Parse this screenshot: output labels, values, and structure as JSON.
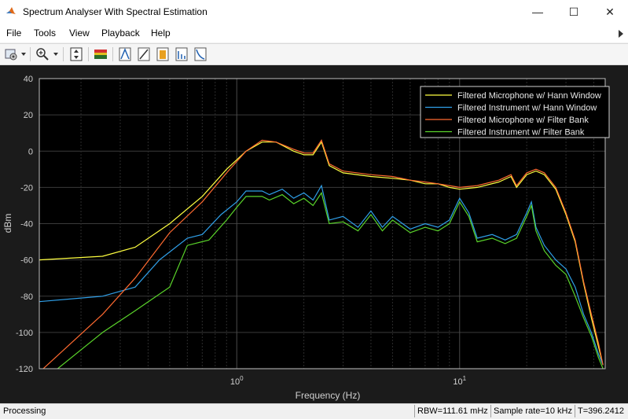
{
  "window": {
    "title": "Spectrum Analyser With Spectral Estimation",
    "minimize_glyph": "—",
    "maximize_glyph": "☐",
    "close_glyph": "✕"
  },
  "menu": {
    "items": [
      "File",
      "Tools",
      "View",
      "Playback",
      "Help"
    ]
  },
  "toolbar": {
    "icons": [
      "settings-icon",
      "zoom-in-icon",
      "scale-axes-icon",
      "spectrum-icon",
      "peak-finder-icon",
      "cursor-icon",
      "channel-measurement-icon",
      "distortion-icon",
      "ccdf-icon"
    ]
  },
  "chart_data": {
    "type": "line",
    "xlabel": "Frequency (Hz)",
    "ylabel": "dBm",
    "xscale": "log",
    "xlim": [
      0.13,
      45
    ],
    "ylim": [
      -120,
      40
    ],
    "yticks": [
      40,
      20,
      0,
      -20,
      -40,
      -60,
      -80,
      -100,
      -120
    ],
    "xtick_labels": [
      {
        "value": 1,
        "base": "10",
        "exp": "0"
      },
      {
        "value": 10,
        "base": "10",
        "exp": "1"
      }
    ],
    "grid": true,
    "legend_position": "top-right",
    "background": "#000000",
    "series": [
      {
        "name": "Filtered Microphone w/ Hann Window",
        "color": "#ffff40",
        "points": [
          [
            0.13,
            -60
          ],
          [
            0.25,
            -58
          ],
          [
            0.35,
            -53
          ],
          [
            0.5,
            -40
          ],
          [
            0.7,
            -25
          ],
          [
            0.9,
            -10
          ],
          [
            1.1,
            0
          ],
          [
            1.3,
            5
          ],
          [
            1.5,
            5
          ],
          [
            1.8,
            0
          ],
          [
            2.0,
            -2
          ],
          [
            2.2,
            -2
          ],
          [
            2.4,
            5
          ],
          [
            2.6,
            -8
          ],
          [
            3.0,
            -12
          ],
          [
            4.0,
            -14
          ],
          [
            5.0,
            -15
          ],
          [
            6.0,
            -16
          ],
          [
            7.0,
            -18
          ],
          [
            8.0,
            -18
          ],
          [
            9.0,
            -20
          ],
          [
            10.0,
            -21
          ],
          [
            12.0,
            -20
          ],
          [
            15.0,
            -17
          ],
          [
            17.0,
            -14
          ],
          [
            18.0,
            -20
          ],
          [
            20.0,
            -13
          ],
          [
            22.0,
            -11
          ],
          [
            24.0,
            -13
          ],
          [
            27.0,
            -21
          ],
          [
            30.0,
            -35
          ],
          [
            33.0,
            -50
          ],
          [
            36.0,
            -73
          ],
          [
            39.0,
            -92
          ],
          [
            42.0,
            -108
          ],
          [
            44.0,
            -118
          ]
        ]
      },
      {
        "name": "Filtered Instrument w/ Hann Window",
        "color": "#2f9fe8",
        "points": [
          [
            0.13,
            -83
          ],
          [
            0.25,
            -80
          ],
          [
            0.35,
            -75
          ],
          [
            0.45,
            -60
          ],
          [
            0.6,
            -48
          ],
          [
            0.7,
            -46
          ],
          [
            0.85,
            -35
          ],
          [
            1.0,
            -28
          ],
          [
            1.1,
            -22
          ],
          [
            1.3,
            -22
          ],
          [
            1.4,
            -24
          ],
          [
            1.6,
            -21
          ],
          [
            1.8,
            -26
          ],
          [
            2.0,
            -23
          ],
          [
            2.2,
            -27
          ],
          [
            2.4,
            -19
          ],
          [
            2.6,
            -38
          ],
          [
            3.0,
            -36
          ],
          [
            3.5,
            -42
          ],
          [
            4.0,
            -33
          ],
          [
            4.5,
            -42
          ],
          [
            5.0,
            -36
          ],
          [
            6.0,
            -43
          ],
          [
            7.0,
            -40
          ],
          [
            8.0,
            -42
          ],
          [
            9.0,
            -38
          ],
          [
            10.0,
            -26
          ],
          [
            11.0,
            -34
          ],
          [
            12.0,
            -48
          ],
          [
            14.0,
            -46
          ],
          [
            16.0,
            -49
          ],
          [
            18.0,
            -46
          ],
          [
            20.0,
            -34
          ],
          [
            21.0,
            -28
          ],
          [
            22.0,
            -42
          ],
          [
            24.0,
            -52
          ],
          [
            27.0,
            -60
          ],
          [
            30.0,
            -65
          ],
          [
            33.0,
            -75
          ],
          [
            36.0,
            -90
          ],
          [
            39.0,
            -100
          ],
          [
            42.0,
            -112
          ],
          [
            44.0,
            -118
          ]
        ]
      },
      {
        "name": "Filtered Microphone w/ Filter Bank",
        "color": "#ff6a30",
        "points": [
          [
            0.13,
            -122
          ],
          [
            0.25,
            -90
          ],
          [
            0.35,
            -70
          ],
          [
            0.5,
            -45
          ],
          [
            0.7,
            -28
          ],
          [
            0.9,
            -12
          ],
          [
            1.1,
            0
          ],
          [
            1.3,
            6
          ],
          [
            1.5,
            5
          ],
          [
            1.8,
            1
          ],
          [
            2.0,
            -1
          ],
          [
            2.2,
            -1
          ],
          [
            2.4,
            6
          ],
          [
            2.6,
            -7
          ],
          [
            3.0,
            -11
          ],
          [
            4.0,
            -13
          ],
          [
            5.0,
            -14
          ],
          [
            6.0,
            -16
          ],
          [
            7.0,
            -17
          ],
          [
            8.0,
            -18
          ],
          [
            9.0,
            -19
          ],
          [
            10.0,
            -20
          ],
          [
            12.0,
            -19
          ],
          [
            15.0,
            -16
          ],
          [
            17.0,
            -13
          ],
          [
            18.0,
            -19
          ],
          [
            20.0,
            -12
          ],
          [
            22.0,
            -10
          ],
          [
            24.0,
            -12
          ],
          [
            27.0,
            -20
          ],
          [
            30.0,
            -34
          ],
          [
            33.0,
            -49
          ],
          [
            36.0,
            -72
          ],
          [
            39.0,
            -90
          ],
          [
            42.0,
            -106
          ],
          [
            44.0,
            -118
          ]
        ]
      },
      {
        "name": "Filtered Instrument w/ Filter Bank",
        "color": "#5ad42a",
        "points": [
          [
            0.15,
            -122
          ],
          [
            0.25,
            -100
          ],
          [
            0.35,
            -88
          ],
          [
            0.5,
            -75
          ],
          [
            0.6,
            -52
          ],
          [
            0.75,
            -49
          ],
          [
            0.9,
            -38
          ],
          [
            1.0,
            -31
          ],
          [
            1.1,
            -25
          ],
          [
            1.3,
            -25
          ],
          [
            1.4,
            -27
          ],
          [
            1.6,
            -24
          ],
          [
            1.8,
            -29
          ],
          [
            2.0,
            -26
          ],
          [
            2.2,
            -30
          ],
          [
            2.4,
            -23
          ],
          [
            2.6,
            -40
          ],
          [
            3.0,
            -39
          ],
          [
            3.5,
            -44
          ],
          [
            4.0,
            -35
          ],
          [
            4.5,
            -44
          ],
          [
            5.0,
            -38
          ],
          [
            6.0,
            -45
          ],
          [
            7.0,
            -42
          ],
          [
            8.0,
            -44
          ],
          [
            9.0,
            -40
          ],
          [
            10.0,
            -28
          ],
          [
            11.0,
            -36
          ],
          [
            12.0,
            -50
          ],
          [
            14.0,
            -48
          ],
          [
            16.0,
            -51
          ],
          [
            18.0,
            -48
          ],
          [
            20.0,
            -36
          ],
          [
            21.0,
            -30
          ],
          [
            22.0,
            -44
          ],
          [
            24.0,
            -55
          ],
          [
            27.0,
            -63
          ],
          [
            30.0,
            -68
          ],
          [
            33.0,
            -80
          ],
          [
            36.0,
            -92
          ],
          [
            39.0,
            -102
          ],
          [
            42.0,
            -114
          ],
          [
            44.0,
            -120
          ]
        ]
      }
    ]
  },
  "status": {
    "left": "Processing",
    "rbw": "RBW=111.61 mHz",
    "sample_rate": "Sample rate=10 kHz",
    "time": "T=396.2412"
  }
}
